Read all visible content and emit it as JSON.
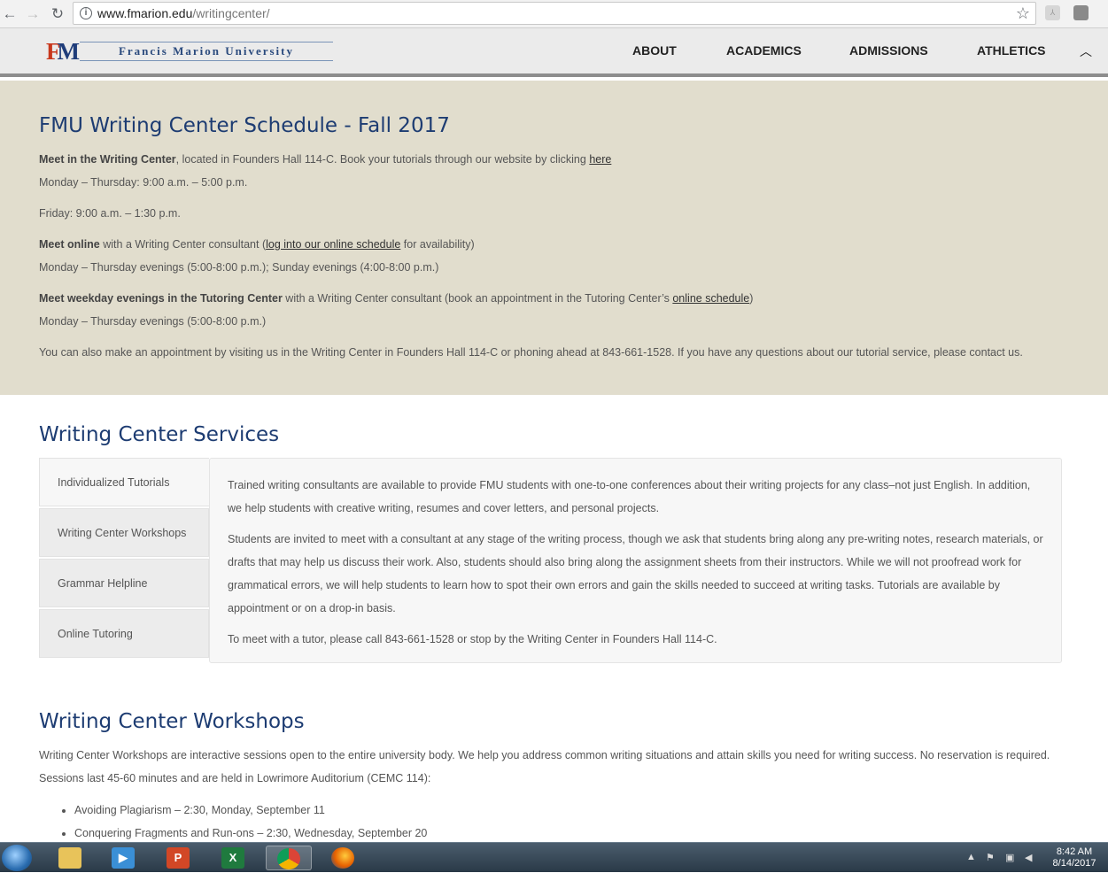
{
  "browser": {
    "url_host": "www.fmarion.edu",
    "url_path": "/writingcenter/"
  },
  "header": {
    "logo_letters_f": "F",
    "logo_letters_m": "M",
    "logo_text": "Francis Marion University",
    "nav": [
      "ABOUT",
      "ACADEMICS",
      "ADMISSIONS",
      "ATHLETICS"
    ]
  },
  "schedule": {
    "title": "FMU Writing Center Schedule - Fall 2017",
    "line1_bold": "Meet in the Writing Center",
    "line1_rest": ", located in Founders Hall 114-C. Book your tutorials through our website by clicking ",
    "line1_link": "here",
    "hours1": "Monday – Thursday: 9:00 a.m. – 5:00 p.m.",
    "hours2": "Friday: 9:00 a.m. – 1:30 p.m.",
    "online_bold": "Meet online",
    "online_rest": " with a Writing Center consultant (",
    "online_link": "log into our online schedule",
    "online_tail": " for availability)",
    "online_hours": "Monday – Thursday evenings (5:00-8:00 p.m.); Sunday evenings (4:00-8:00 p.m.)",
    "evening_bold": "Meet weekday evenings in the Tutoring Center",
    "evening_rest": " with a Writing Center consultant (book an appointment in the Tutoring Center’s ",
    "evening_link": "online schedule",
    "evening_tail": ")",
    "evening_hours": "Monday – Thursday evenings (5:00-8:00 p.m.)",
    "appointment": "You can also make an appointment by visiting us in the Writing Center in Founders Hall 114-C or phoning ahead at 843-661-1528. If you have any questions about our tutorial service, please contact us."
  },
  "services": {
    "title": "Writing Center Services",
    "tabs": [
      "Individualized Tutorials",
      "Writing Center Workshops",
      "Grammar Helpline",
      "Online Tutoring"
    ],
    "panel": [
      "Trained writing consultants are available to provide FMU students with one-to-one conferences about their writing projects for any class–not just English. In addition, we help students with creative writing, resumes and cover letters, and personal projects.",
      "Students are invited to meet with a consultant at any stage of the writing process, though we ask that students bring along any pre-writing notes, research materials, or drafts that may help us discuss their work. Also, students should also bring along the assignment sheets from their instructors. While we will not proofread work for grammatical errors, we will help students to learn how to spot their own errors and gain the skills needed to succeed at writing tasks. Tutorials are available by appointment or on a drop-in basis.",
      "To meet with a tutor, please call 843-661-1528 or stop by the Writing Center in Founders Hall 114-C."
    ]
  },
  "workshops": {
    "title": "Writing Center Workshops",
    "intro": "Writing Center Workshops are interactive sessions open to the entire university body. We help you address common writing situations and attain skills you need for writing success. No reservation is required. Sessions last 45-60 minutes and are held in Lowrimore Auditorium (CEMC 114):",
    "items": [
      "Avoiding Plagiarism – 2:30, Monday, September 11",
      "Conquering Fragments and Run-ons – 2:30, Wednesday, September 20"
    ]
  },
  "taskbar": {
    "time": "8:42 AM",
    "date": "8/14/2017"
  }
}
